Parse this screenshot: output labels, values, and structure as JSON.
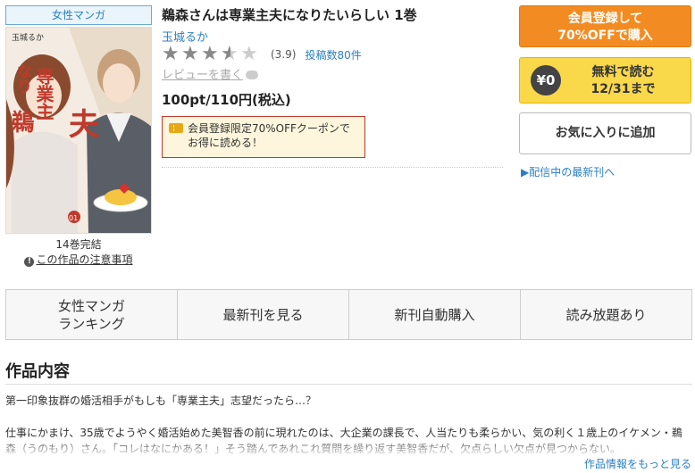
{
  "book": {
    "genre_tag": "女性マンガ",
    "title": "鵜森さんは専業主夫になりたいらしい 1巻",
    "author": "玉城るか",
    "rating": 3.9,
    "rating_text": "(3.9)",
    "review_count": "投稿数80件",
    "write_review": "レビューを書く",
    "price": "100pt/110円(税込)",
    "coupon_text": "会員登録限定70%OFFクーポンで お得に読める！",
    "volumes_note": "14巻完結",
    "caution_link": "この作品の注意事項",
    "cover": {
      "author_text": "玉城るか",
      "title_text": "鵜森さんは専業主夫になりたい",
      "volume_badge": "01"
    }
  },
  "actions": {
    "register_line1": "会員登録して",
    "register_line2": "70%OFFで購入",
    "free_badge": "¥0",
    "free_line1": "無料で読む",
    "free_line2": "12/31まで",
    "favorite": "お気に入りに追加",
    "latest_link": "▶配信中の最新刊へ"
  },
  "tabs": [
    {
      "label": "女性マンガ\nランキング"
    },
    {
      "label": "最新刊を見る"
    },
    {
      "label": "新刊自動購入"
    },
    {
      "label": "読み放題あり"
    }
  ],
  "description": {
    "heading": "作品内容",
    "para1": "第一印象抜群の婚活相手がもしも「専業主夫」志望だったら…？",
    "para2": "仕事にかまけ、35歳でようやく婚活始めた美智香の前に現れたのは、大企業の課長で、人当たりも柔らかい、気の利く１歳上のイケメン・鵜森（うのもり）さん。「コレはなにかある！」そう踏んであれこれ質問を繰り返す美智香だが、欠点らしい欠点が見つからない。",
    "more_link": "作品情報をもっと見る"
  },
  "colors": {
    "accent_orange": "#f28c22",
    "accent_yellow": "#f9d84a",
    "link_blue": "#2b7fc0",
    "coupon_border": "#c0392b"
  }
}
